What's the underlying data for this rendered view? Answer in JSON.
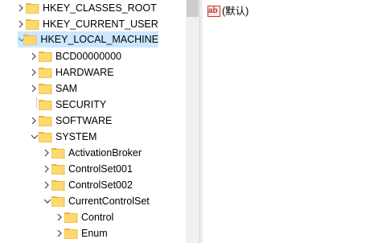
{
  "tree": {
    "items": [
      {
        "label": "HKEY_CLASSES_ROOT",
        "expander": "collapsed"
      },
      {
        "label": "HKEY_CURRENT_USER",
        "expander": "collapsed"
      },
      {
        "label": "HKEY_LOCAL_MACHINE",
        "expander": "expanded",
        "selected": true
      },
      {
        "label": "BCD00000000",
        "expander": "collapsed"
      },
      {
        "label": "HARDWARE",
        "expander": "collapsed"
      },
      {
        "label": "SAM",
        "expander": "collapsed"
      },
      {
        "label": "SECURITY",
        "expander": "none"
      },
      {
        "label": "SOFTWARE",
        "expander": "collapsed"
      },
      {
        "label": "SYSTEM",
        "expander": "expanded"
      },
      {
        "label": "ActivationBroker",
        "expander": "collapsed"
      },
      {
        "label": "ControlSet001",
        "expander": "collapsed"
      },
      {
        "label": "ControlSet002",
        "expander": "collapsed"
      },
      {
        "label": "CurrentControlSet",
        "expander": "expanded"
      },
      {
        "label": "Control",
        "expander": "collapsed"
      },
      {
        "label": "Enum",
        "expander": "collapsed"
      }
    ]
  },
  "values": {
    "rows": [
      {
        "icon": "string-value-icon",
        "icon_text": "ab",
        "name": "(默认)"
      }
    ]
  },
  "colors": {
    "selection": "#cce8ff",
    "folder_fill": "#ffd86e",
    "folder_tab": "#e8b742",
    "chevron": "#444444",
    "chevron_expanded": "#3b8ed7"
  }
}
